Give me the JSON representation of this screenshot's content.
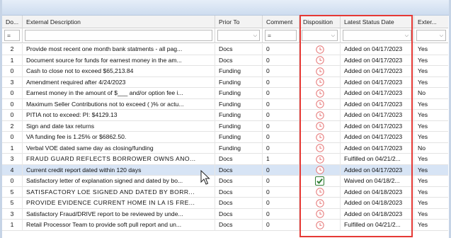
{
  "columns": [
    {
      "label": "Do..."
    },
    {
      "label": "External Description"
    },
    {
      "label": "Prior To"
    },
    {
      "label": "Comment"
    },
    {
      "label": "Disposition"
    },
    {
      "label": "Latest Status Date"
    },
    {
      "label": "Exter..."
    }
  ],
  "filters": {
    "doc_operator": "=",
    "comment_operator": "="
  },
  "rows": [
    {
      "doc": "2",
      "desc": "Provide most recent one month bank statments - all pag...",
      "prior": "Docs",
      "comment": "0",
      "disposition_icon": "clock-icon",
      "status": "Added on 04/17/2023",
      "ext": "Yes"
    },
    {
      "doc": "1",
      "desc": "Document source for funds for earnest money in the am...",
      "prior": "Docs",
      "comment": "0",
      "disposition_icon": "clock-icon",
      "status": "Added on 04/17/2023",
      "ext": "Yes"
    },
    {
      "doc": "0",
      "desc": "Cash to close not to exceed $65,213.84",
      "prior": "Funding",
      "comment": "0",
      "disposition_icon": "clock-icon",
      "status": "Added on 04/17/2023",
      "ext": "Yes"
    },
    {
      "doc": "3",
      "desc": "Amendment required after 4/24/2023",
      "prior": "Funding",
      "comment": "0",
      "disposition_icon": "clock-icon",
      "status": "Added on 04/17/2023",
      "ext": "Yes"
    },
    {
      "doc": "0",
      "desc": "Earnest money in the amount of $___ and/or option fee i...",
      "prior": "Funding",
      "comment": "0",
      "disposition_icon": "clock-icon",
      "status": "Added on 04/17/2023",
      "ext": "No"
    },
    {
      "doc": "0",
      "desc": "Maximum Seller Contributions not to exceed ( )% or actu...",
      "prior": "Funding",
      "comment": "0",
      "disposition_icon": "clock-icon",
      "status": "Added on 04/17/2023",
      "ext": "Yes"
    },
    {
      "doc": "0",
      "desc": "PITIA not to exceed: PI: $4129.13",
      "prior": "Funding",
      "comment": "0",
      "disposition_icon": "clock-icon",
      "status": "Added on 04/17/2023",
      "ext": "Yes"
    },
    {
      "doc": "2",
      "desc": "Sign and date tax returns",
      "prior": "Funding",
      "comment": "0",
      "disposition_icon": "clock-icon",
      "status": "Added on 04/17/2023",
      "ext": "Yes"
    },
    {
      "doc": "0",
      "desc": "VA funding fee is 1.25% or $6862.50.",
      "prior": "Funding",
      "comment": "0",
      "disposition_icon": "clock-icon",
      "status": "Added on 04/17/2023",
      "ext": "Yes"
    },
    {
      "doc": "1",
      "desc": "Verbal VOE dated same day as closing/funding",
      "prior": "Funding",
      "comment": "0",
      "disposition_icon": "clock-icon",
      "status": "Added on 04/17/2023",
      "ext": "No"
    },
    {
      "doc": "3",
      "desc": "FRAUD GUARD REFLECTS BORROWER OWNS ANO...",
      "prior": "Docs",
      "comment": "1",
      "disposition_icon": "clock-icon",
      "status": "Fulfilled on 04/21/2...",
      "ext": "Yes",
      "caps": true
    },
    {
      "doc": "4",
      "desc": "Current credit report dated within 120 days",
      "prior": "Docs",
      "comment": "0",
      "disposition_icon": "clock-icon",
      "status": "Added on 04/17/2023",
      "ext": "Yes",
      "selected": true
    },
    {
      "doc": "0",
      "desc": "Satisfactory letter of explanation signed and dated by bo...",
      "prior": "Docs",
      "comment": "0",
      "disposition_icon": "check-icon",
      "status": "Waived on 04/18/2...",
      "ext": "Yes"
    },
    {
      "doc": "5",
      "desc": "SATISFACTORY LOE SIGNED AND DATED BY BORR...",
      "prior": "Docs",
      "comment": "0",
      "disposition_icon": "clock-icon",
      "status": "Added on 04/18/2023",
      "ext": "Yes",
      "caps": true
    },
    {
      "doc": "5",
      "desc": "PROVIDE EVIDENCE CURRENT HOME IN LA IS FRE...",
      "prior": "Docs",
      "comment": "0",
      "disposition_icon": "clock-icon",
      "status": "Added on 04/18/2023",
      "ext": "Yes",
      "caps": true
    },
    {
      "doc": "3",
      "desc": "Satisfactory Fraud/DRIVE report to be reviewed by unde...",
      "prior": "Docs",
      "comment": "0",
      "disposition_icon": "clock-icon",
      "status": "Added on 04/18/2023",
      "ext": "Yes"
    },
    {
      "doc": "1",
      "desc": "Retail Processor Team to provide soft pull report and un...",
      "prior": "Docs",
      "comment": "0",
      "disposition_icon": "clock-icon",
      "status": "Fulfilled on 04/21/2...",
      "ext": "Yes"
    }
  ],
  "colors": {
    "highlight_border": "#e53935",
    "selected_row": "#d7e4f5",
    "clock_icon": "#e57373",
    "check_icon": "#2e7d32"
  }
}
